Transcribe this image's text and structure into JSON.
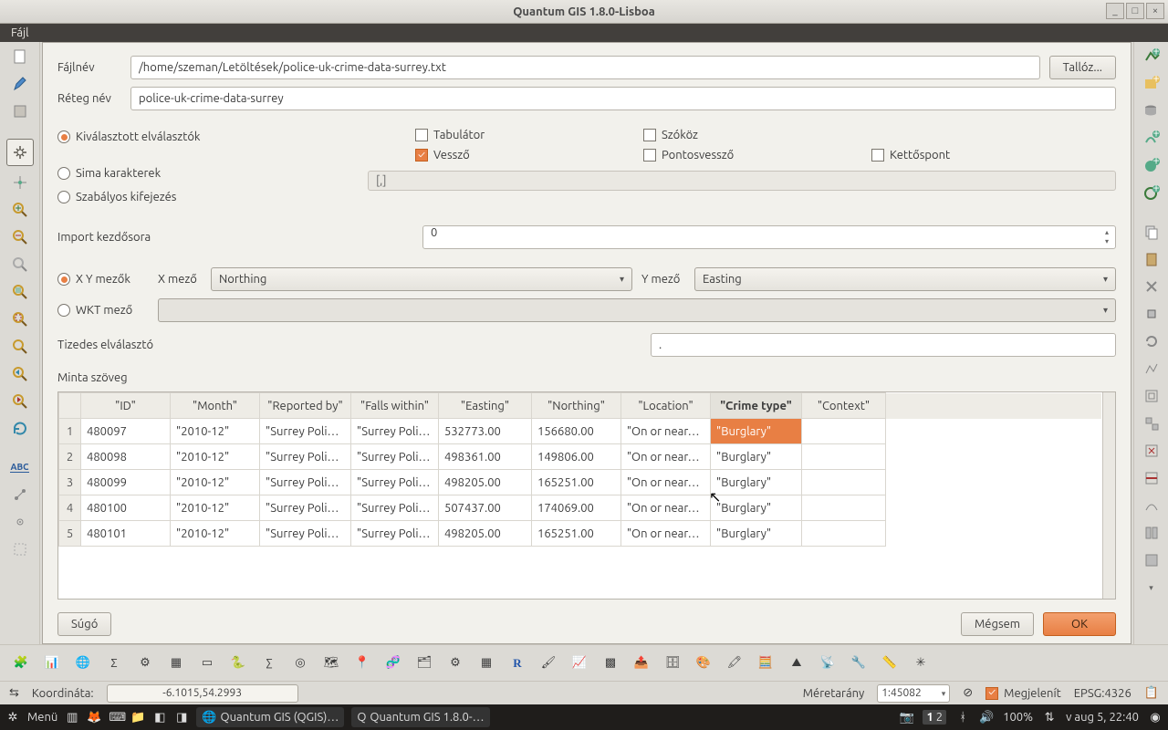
{
  "window": {
    "title": "Quantum GIS 1.8.0-Lisboa"
  },
  "menubar": {
    "file": "Fájl"
  },
  "dialog": {
    "filename_label": "Fájlnév",
    "filename_value": "/home/szeman/Letöltések/police-uk-crime-data-surrey.txt",
    "browse_btn": "Tallóz...",
    "layer_label": "Réteg név",
    "layer_value": "police-uk-crime-data-surrey",
    "delim_selected_label": "Kiválasztott elválasztók",
    "delim_plain_label": "Sima karakterek",
    "delim_regex_label": "Szabályos kifejezés",
    "plain_chars_value": "[,]",
    "delim_tab": "Tabulátor",
    "delim_space": "Szóköz",
    "delim_comma": "Vessző",
    "delim_semicolon": "Pontosvessző",
    "delim_colon": "Kettőspont",
    "skip_label": "Import kezdősora",
    "skip_value": "0",
    "xy_label": "X Y mezők",
    "x_label": "X mező",
    "x_value": "Northing",
    "y_label": "Y mező",
    "y_value": "Easting",
    "wkt_label": "WKT mező",
    "decimal_label": "Tizedes elválasztó",
    "decimal_value": ".",
    "sample_label": "Minta szöveg",
    "help_btn": "Súgó",
    "cancel_btn": "Mégsem",
    "ok_btn": "OK"
  },
  "table": {
    "headers": [
      "\"ID\"",
      "\"Month\"",
      "\"Reported by\"",
      "\"Falls within\"",
      "\"Easting\"",
      "\"Northing\"",
      "\"Location\"",
      "\"Crime type\"",
      "\"Context\""
    ],
    "rows": [
      {
        "n": "1",
        "id": "480097",
        "month": "\"2010-12\"",
        "rep": "\"Surrey Poli…",
        "falls": "\"Surrey Poli…",
        "east": "532773.00",
        "north": "156680.00",
        "loc": "\"On or near…",
        "crime": "\"Burglary\"",
        "ctx": ""
      },
      {
        "n": "2",
        "id": "480098",
        "month": "\"2010-12\"",
        "rep": "\"Surrey Poli…",
        "falls": "\"Surrey Poli…",
        "east": "498361.00",
        "north": "149806.00",
        "loc": "\"On or near…",
        "crime": "\"Burglary\"",
        "ctx": ""
      },
      {
        "n": "3",
        "id": "480099",
        "month": "\"2010-12\"",
        "rep": "\"Surrey Poli…",
        "falls": "\"Surrey Poli…",
        "east": "498205.00",
        "north": "165251.00",
        "loc": "\"On or near…",
        "crime": "\"Burglary\"",
        "ctx": ""
      },
      {
        "n": "4",
        "id": "480100",
        "month": "\"2010-12\"",
        "rep": "\"Surrey Poli…",
        "falls": "\"Surrey Poli…",
        "east": "507437.00",
        "north": "174069.00",
        "loc": "\"On or near…",
        "crime": "\"Burglary\"",
        "ctx": ""
      },
      {
        "n": "5",
        "id": "480101",
        "month": "\"2010-12\"",
        "rep": "\"Surrey Poli…",
        "falls": "\"Surrey Poli…",
        "east": "498205.00",
        "north": "165251.00",
        "loc": "\"On or near…",
        "crime": "\"Burglary\"",
        "ctx": ""
      }
    ]
  },
  "statusbar": {
    "coord_label": "Koordináta:",
    "coord_value": "-6.1015,54.2993",
    "scale_label": "Méretarány",
    "scale_value": "1:45082",
    "render_label": "Megjelenít",
    "crs_label": "EPSG:4326"
  },
  "taskbar": {
    "menu": "Menü",
    "task1": "Quantum GIS (QGIS)…",
    "task2": "Quantum GIS 1.8.0-…",
    "zoom": "100%",
    "clock": "v aug  5, 22:40"
  },
  "winbtns": {
    "min": "_",
    "max": "□",
    "close": "×"
  }
}
